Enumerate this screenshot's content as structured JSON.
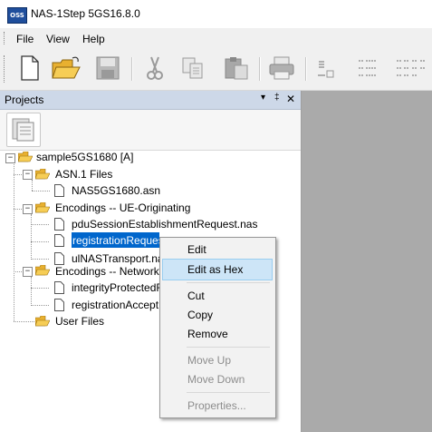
{
  "window": {
    "app_icon_text": "OSS",
    "title": "NAS-1Step 5GS16.8.0"
  },
  "menubar": {
    "items": [
      {
        "label": "File"
      },
      {
        "label": "View"
      },
      {
        "label": "Help"
      }
    ]
  },
  "toolbar": {
    "icons": [
      "new-file-icon",
      "open-folder-icon",
      "save-icon",
      "cut-icon",
      "copy-icon",
      "paste-icon",
      "print-icon",
      "encode-icon",
      "tree-collapse-icon",
      "tree-expand-icon"
    ]
  },
  "panel": {
    "title": "Projects",
    "pin_glyph": "▾",
    "autohide_glyph": "‡",
    "close_glyph": "✕"
  },
  "tree": {
    "root": {
      "label": "sample5GS1680 [A]",
      "expander": "−"
    },
    "asn_folder": {
      "label": "ASN.1 Files",
      "expander": "−"
    },
    "asn_file": {
      "label": "NAS5GS1680.asn"
    },
    "ue_folder": {
      "label": "Encodings -- UE-Originating",
      "expander": "−"
    },
    "ue_files": [
      {
        "label": "pduSessionEstablishmentRequest.nas"
      },
      {
        "label": "registrationRequest.nas"
      },
      {
        "label": "ulNASTransport.nas"
      }
    ],
    "net_folder": {
      "label": "Encodings -- Network-Originating",
      "expander": "−"
    },
    "net_files": [
      {
        "label": "integrityProtectedRegistrationAccept.nas"
      },
      {
        "label": "registrationAccept.nas"
      }
    ],
    "user_folder": {
      "label": "User Files"
    }
  },
  "context_menu": {
    "edit": "Edit",
    "edit_hex": "Edit as Hex",
    "cut": "Cut",
    "copy": "Copy",
    "remove": "Remove",
    "move_up": "Move Up",
    "move_down": "Move Down",
    "properties": "Properties..."
  },
  "colors": {
    "selection": "#0066cc",
    "hover": "#cde5f7",
    "panel_header": "#cdd8e8",
    "workspace": "#aaaaaa"
  }
}
